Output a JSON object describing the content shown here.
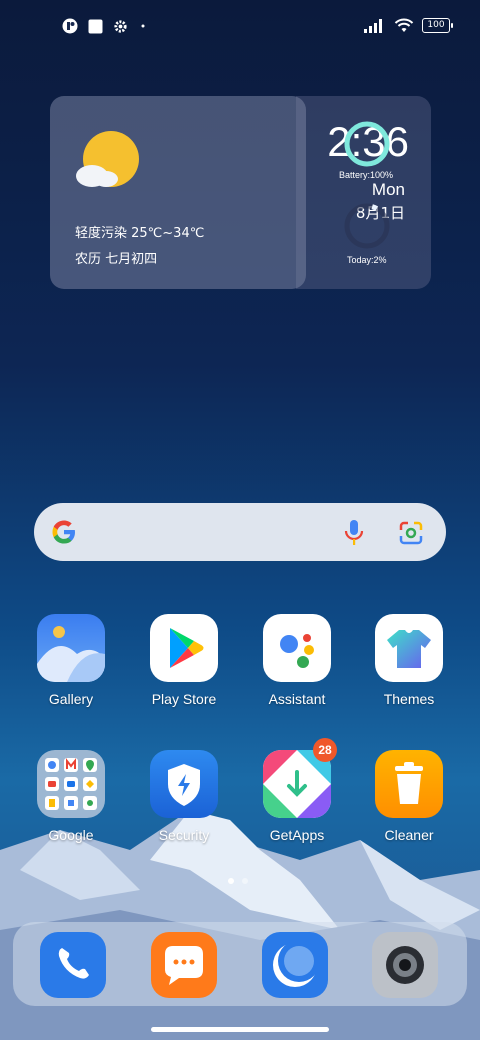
{
  "status_bar": {
    "battery": "100"
  },
  "widget": {
    "time": "2:36",
    "day_of_week": "Mon",
    "date": "8月1日",
    "weather": "轻度污染 25℃~34℃",
    "lunar": "农历 七月初四",
    "battery_label": "Battery:100%",
    "today_label": "Today:2%",
    "battery_level": 1.0,
    "today_level": 0.02
  },
  "apps": [
    {
      "label": "Gallery",
      "icon": "gallery-icon"
    },
    {
      "label": "Play Store",
      "icon": "play-store-icon"
    },
    {
      "label": "Assistant",
      "icon": "assistant-icon"
    },
    {
      "label": "Themes",
      "icon": "themes-icon"
    },
    {
      "label": "Google",
      "icon": "google-folder-icon"
    },
    {
      "label": "Security",
      "icon": "security-icon"
    },
    {
      "label": "GetApps",
      "icon": "getapps-icon",
      "badge": "28"
    },
    {
      "label": "Cleaner",
      "icon": "cleaner-icon"
    }
  ],
  "dock": [
    {
      "icon": "phone-icon"
    },
    {
      "icon": "messaging-icon"
    },
    {
      "icon": "browser-icon"
    },
    {
      "icon": "camera-icon"
    }
  ],
  "colors": {
    "ring": "#7fe8dc",
    "badge": "#f0582a"
  }
}
